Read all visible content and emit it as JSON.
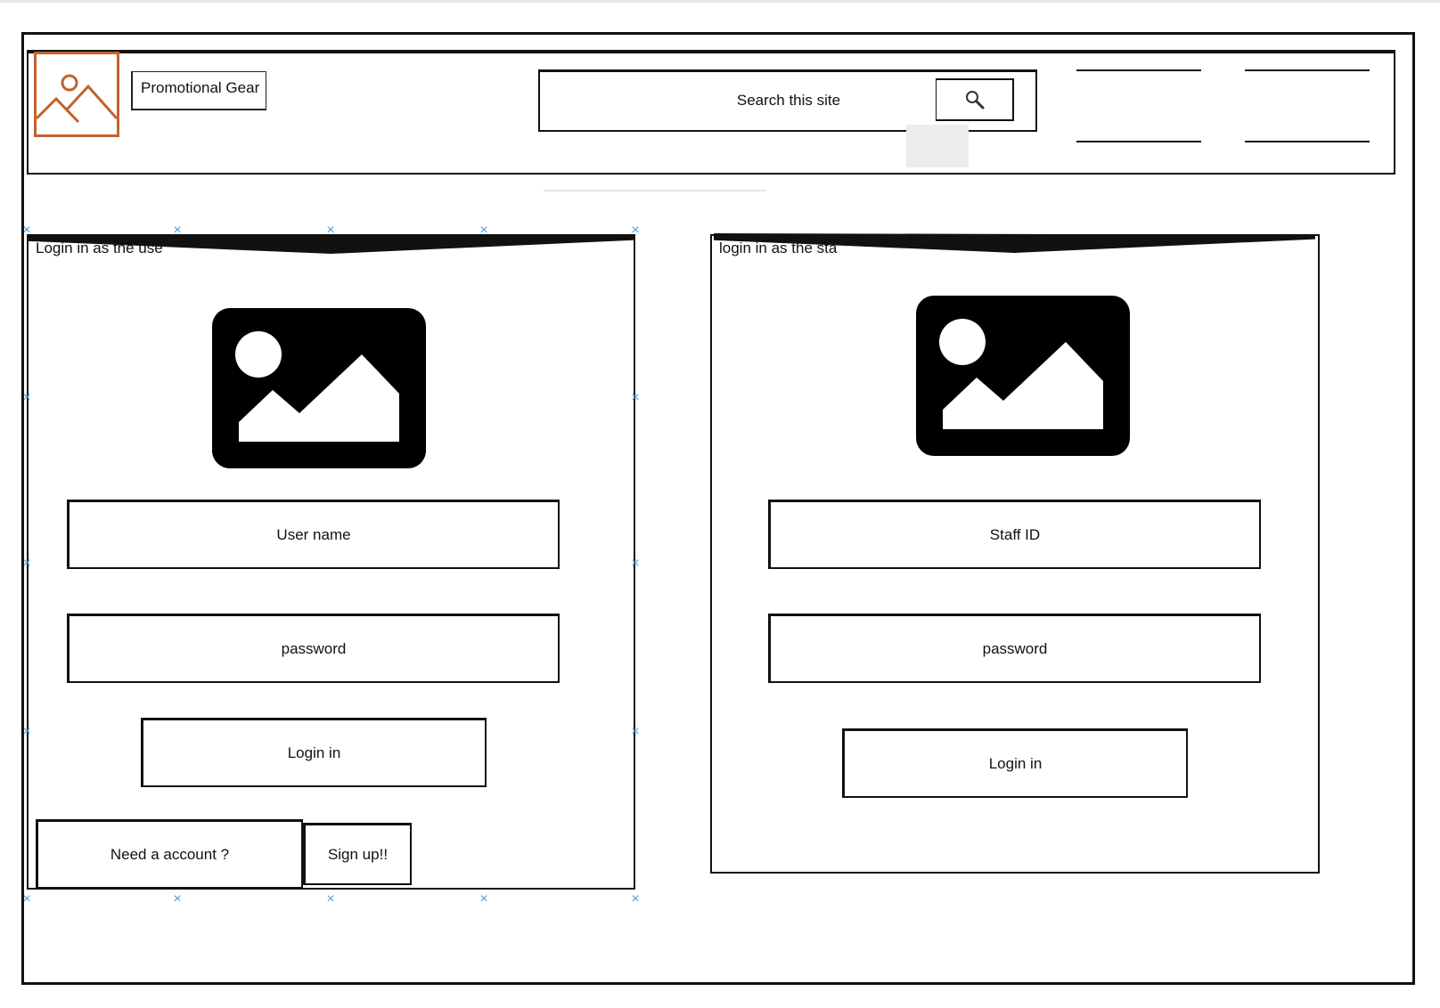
{
  "header": {
    "brand": "Promotional Gear",
    "search_placeholder": "Search this site",
    "search_icon": "magnifier-icon",
    "logo_icon": "image-placeholder-icon",
    "logo_color": "#c4622d"
  },
  "user_panel": {
    "title": "Login in as the use",
    "image_icon": "image-placeholder-icon",
    "username_placeholder": "User name",
    "password_placeholder": "password",
    "login_label": "Login in",
    "need_account_label": "Need a account ?",
    "signup_label": "Sign up!!"
  },
  "staff_panel": {
    "title": "login in as the sta",
    "image_icon": "image-placeholder-icon",
    "staff_id_placeholder": "Staff ID",
    "password_placeholder": "password",
    "login_label": "Login in"
  },
  "colors": {
    "selection_handle": "#4a9fe0",
    "logo_border": "#c4622d"
  }
}
